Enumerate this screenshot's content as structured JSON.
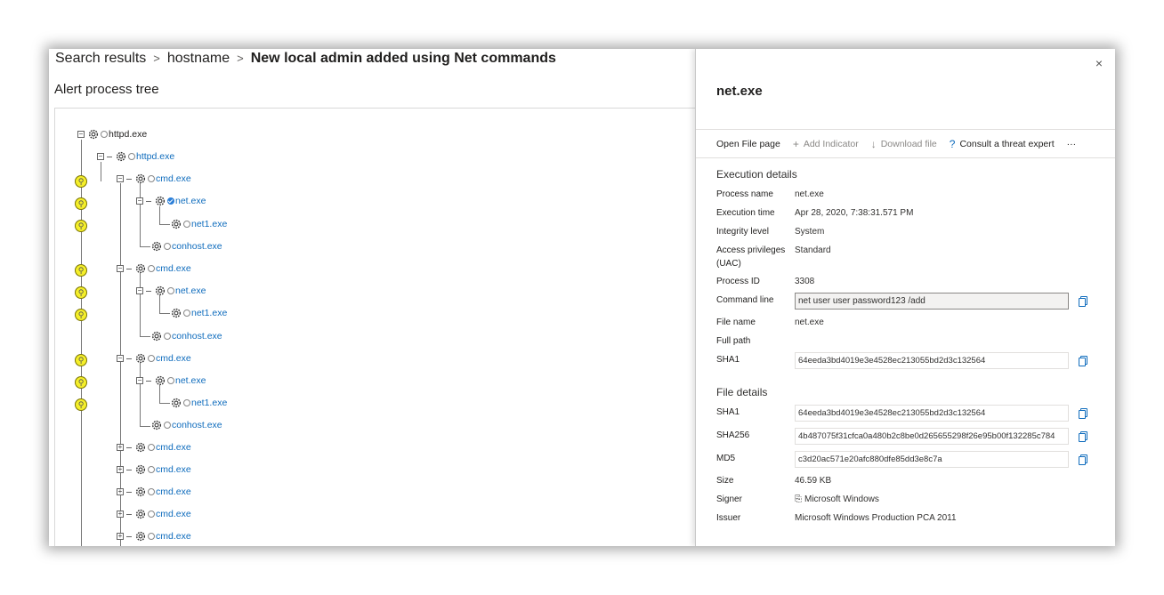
{
  "breadcrumb": {
    "item1": "Search results",
    "item2": "hostname",
    "current": "New local admin added using Net commands"
  },
  "tree": {
    "title": "Alert process tree",
    "nodes": [
      {
        "label": "httpd.exe"
      },
      {
        "label": "httpd.exe"
      },
      {
        "label": "cmd.exe"
      },
      {
        "label": "net.exe"
      },
      {
        "label": "net1.exe"
      },
      {
        "label": "conhost.exe"
      },
      {
        "label": "cmd.exe"
      },
      {
        "label": "net.exe"
      },
      {
        "label": "net1.exe"
      },
      {
        "label": "conhost.exe"
      },
      {
        "label": "cmd.exe"
      },
      {
        "label": "net.exe"
      },
      {
        "label": "net1.exe"
      },
      {
        "label": "conhost.exe"
      },
      {
        "label": "cmd.exe"
      },
      {
        "label": "cmd.exe"
      },
      {
        "label": "cmd.exe"
      },
      {
        "label": "cmd.exe"
      },
      {
        "label": "cmd.exe"
      }
    ],
    "expander_collapsed": "+",
    "expander_expanded": "−",
    "alert_icon": "alert-marker-icon"
  },
  "panel": {
    "close": "×",
    "title": "net.exe",
    "actions": {
      "open_file_page": "Open File page",
      "add_indicator": "Add Indicator",
      "download_file": "Download file",
      "consult_expert": "Consult a threat expert",
      "more": "···"
    },
    "execution": {
      "title": "Execution details",
      "process_name_label": "Process name",
      "process_name": "net.exe",
      "execution_time_label": "Execution time",
      "execution_time": "Apr 28, 2020, 7:38:31.571 PM",
      "integrity_label": "Integrity level",
      "integrity": "System",
      "access_label": "Access privileges (UAC)",
      "access": "Standard",
      "pid_label": "Process ID",
      "pid": "3308",
      "cmdline_label": "Command line",
      "cmdline": "net user  user password123  /add",
      "file_name_label": "File name",
      "file_name": "net.exe",
      "full_path_label": "Full path",
      "sha1_label": "SHA1",
      "sha1": "64eeda3bd4019e3e4528ec213055bd2d3c132564"
    },
    "file": {
      "title": "File details",
      "sha1_label": "SHA1",
      "sha1": "64eeda3bd4019e3e4528ec213055bd2d3c132564",
      "sha256_label": "SHA256",
      "sha256": "4b487075f31cfca0a480b2c8be0d265655298f26e95b00f132285c784",
      "md5_label": "MD5",
      "md5": "c3d20ac571e20afc880dfe85dd3e8c7a",
      "size_label": "Size",
      "size": "46.59 KB",
      "signer_label": "Signer",
      "signer": "Microsoft Windows",
      "issuer_label": "Issuer",
      "issuer": "Microsoft Windows Production PCA 2011"
    }
  },
  "colors": {
    "link": "#0f6cbd",
    "alert": "#f5ef2a"
  }
}
